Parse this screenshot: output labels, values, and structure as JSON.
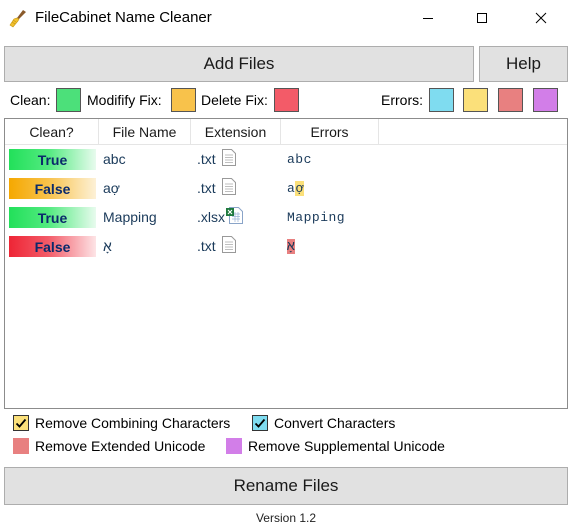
{
  "window": {
    "title": "FileCabinet Name Cleaner",
    "app_icon": "broom-icon",
    "controls": [
      "minimize-icon",
      "maximize-icon",
      "close-icon"
    ]
  },
  "toolbar": {
    "add_files_label": "Add Files",
    "help_label": "Help"
  },
  "legend": {
    "clean_label": "Clean:",
    "modify_label": "Modifify Fix:",
    "delete_label": "Delete Fix:",
    "errors_label": "Errors:",
    "colors": {
      "clean": "#4ce07a",
      "modify": "#f8c24b",
      "delete": "#f35b68",
      "error_cyan": "#7fdcf0",
      "error_yellow": "#fbe07a",
      "error_red": "#e88080",
      "error_purple": "#d27ee8"
    }
  },
  "table": {
    "columns": [
      "Clean?",
      "File Name",
      "Extension",
      "Errors"
    ],
    "rows": [
      {
        "status": "True",
        "status_type": "clean",
        "name": "abc",
        "ext": ".txt",
        "ext_icon": "text-file-icon",
        "errors": "abc"
      },
      {
        "status": "False",
        "status_type": "modify",
        "name": "aợ",
        "ext": ".txt",
        "ext_icon": "text-file-icon",
        "errors_plain": "a",
        "errors_flagged": "ợ"
      },
      {
        "status": "True",
        "status_type": "clean",
        "name": "Mapping",
        "ext": ".xlsx",
        "ext_icon": "excel-file-icon",
        "errors": "Mapping"
      },
      {
        "status": "False",
        "status_type": "delete",
        "name": "אָ",
        "ext": ".txt",
        "ext_icon": "text-file-icon",
        "errors_flagged": "אָ"
      }
    ]
  },
  "options": {
    "remove_combining": {
      "label": "Remove Combining Characters",
      "checked": true,
      "color": "#fbe07a"
    },
    "convert_chars": {
      "label": "Convert Characters",
      "checked": true,
      "color": "#7fdcf0"
    },
    "remove_extended": {
      "label": "Remove Extended Unicode",
      "checked": false,
      "color": "#e88080"
    },
    "remove_supplemental": {
      "label": "Remove Supplemental Unicode",
      "checked": false,
      "color": "#d27ee8"
    }
  },
  "rename_label": "Rename Files",
  "version": "Version 1.2"
}
